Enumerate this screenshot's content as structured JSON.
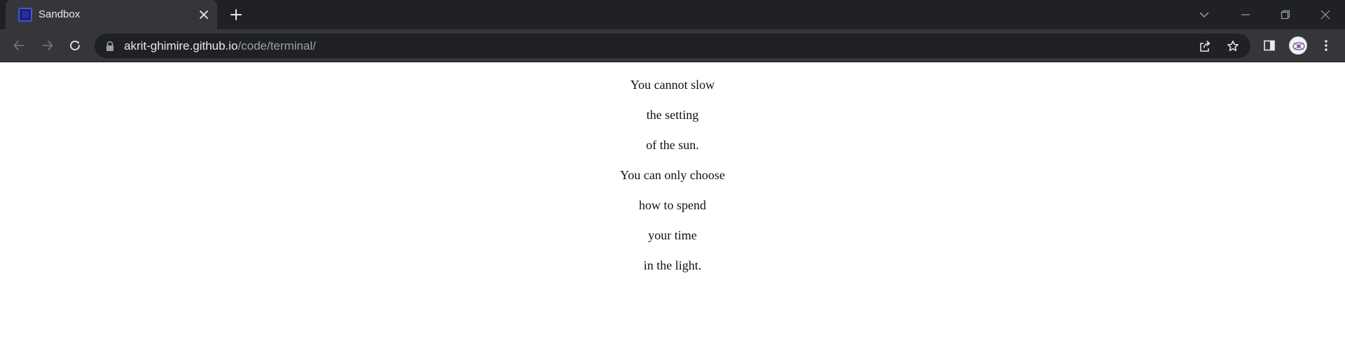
{
  "browser": {
    "tab": {
      "title": "Sandbox",
      "favicon": "sandbox-favicon-icon"
    },
    "address_bar": {
      "host": "akrit-ghimire.github.io",
      "path": "/code/terminal/"
    },
    "colors": {
      "tabstrip": "#202124",
      "toolbar": "#35363a",
      "omnibox": "#202124",
      "text": "#e8eaed",
      "url_path": "#9aa0a6"
    }
  },
  "page": {
    "lines": [
      "You cannot slow",
      "the setting",
      "of the sun.",
      "You can only choose",
      "how to spend",
      "your time",
      "in the light."
    ]
  }
}
